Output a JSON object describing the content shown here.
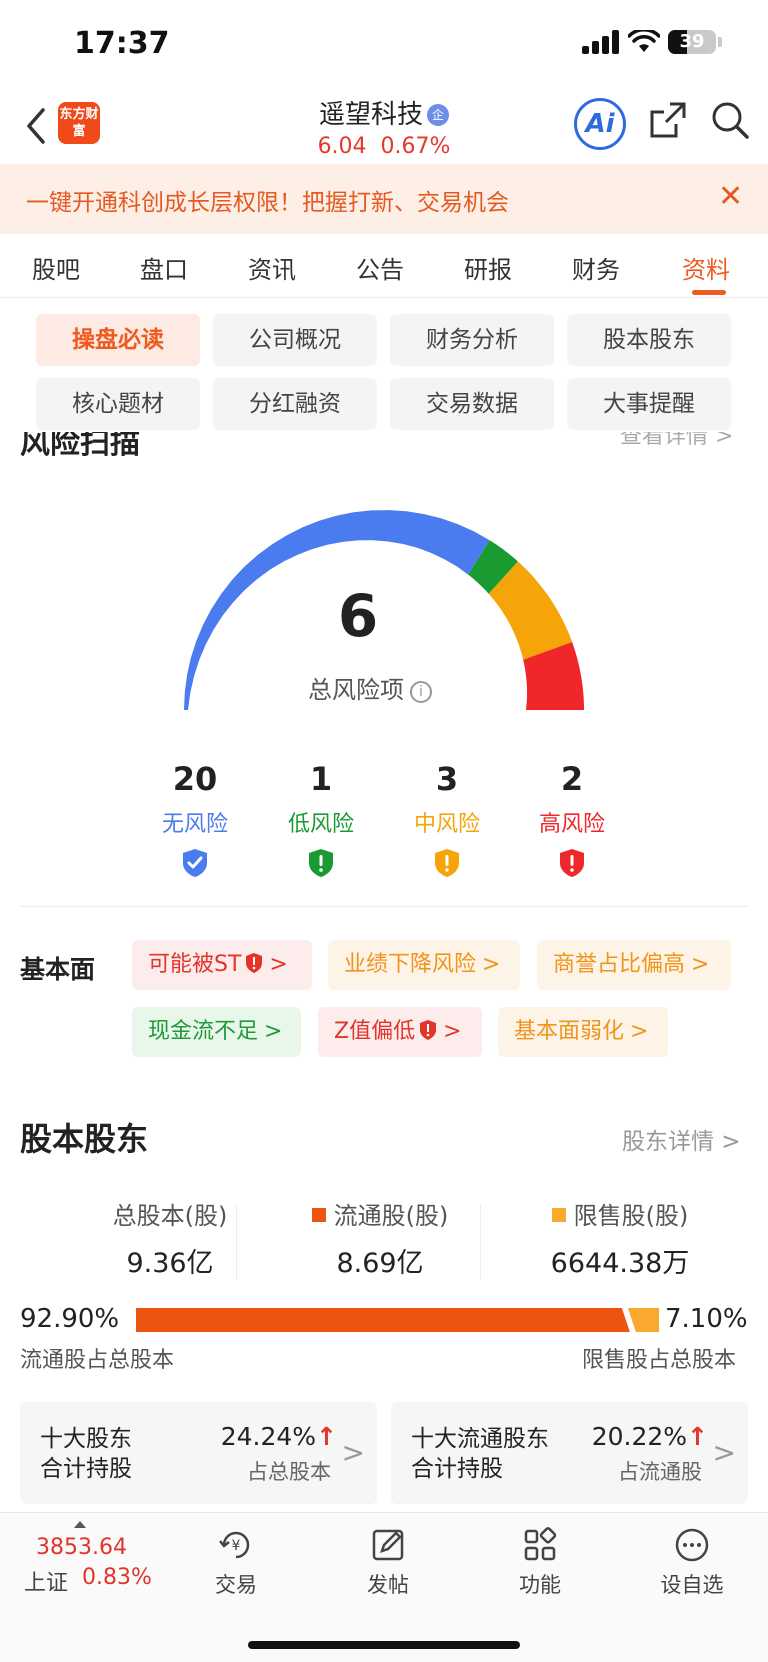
{
  "status": {
    "time": "17:37",
    "battery": "39"
  },
  "nav": {
    "logo": "东方财富",
    "title": "遥望科技",
    "badge": "企",
    "price": "6.04",
    "change": "0.67%",
    "ai_label": "Ai"
  },
  "banner": {
    "text": "一键开通科创成长层权限！把握打新、交易机会",
    "close": "✕"
  },
  "tabs": [
    "股吧",
    "盘口",
    "资讯",
    "公告",
    "研报",
    "财务",
    "资料"
  ],
  "chips": [
    "操盘必读",
    "公司概况",
    "财务分析",
    "股本股东",
    "核心题材",
    "分红融资",
    "交易数据",
    "大事提醒"
  ],
  "risk_section": {
    "title": "风险扫描",
    "link": "查看详情 >",
    "total": "6",
    "total_label": "总风险项",
    "info_icon": "i",
    "colors": {
      "none": "#4a7cf0",
      "low": "#1a9b32",
      "mid": "#f5a50a",
      "high": "#f0272a"
    },
    "gauge_values": {
      "none": 20,
      "low": 1,
      "mid": 3,
      "high": 2
    },
    "items": [
      {
        "count": "20",
        "label": "无风险"
      },
      {
        "count": "1",
        "label": "低风险"
      },
      {
        "count": "3",
        "label": "中风险"
      },
      {
        "count": "2",
        "label": "高风险"
      }
    ]
  },
  "fundamentals": {
    "label": "基本面",
    "tags": [
      {
        "text": "可能被ST",
        "chev": ">"
      },
      {
        "text": "业绩下降风险",
        "chev": ">"
      },
      {
        "text": "商誉占比偏高",
        "chev": ">"
      },
      {
        "text": "现金流不足",
        "chev": ">"
      },
      {
        "text": "Z值偏低",
        "chev": ">"
      },
      {
        "text": "基本面弱化",
        "chev": ">"
      }
    ]
  },
  "shareholders": {
    "title": "股本股东",
    "link": "股东详情 >",
    "total_label": "总股本(股)",
    "total_value": "9.36亿",
    "float_label": "流通股(股)",
    "float_value": "8.69亿",
    "restricted_label": "限售股(股)",
    "restricted_value": "6644.38万",
    "float_pct": "92.90%",
    "restricted_pct": "7.10%",
    "float_share": 0.929,
    "float_pct_label": "流通股占总股本",
    "restricted_pct_label": "限售股占总股本",
    "colors": {
      "float": "#ec5510",
      "restricted": "#f9aa2e"
    },
    "cards": [
      {
        "line1": "十大股东",
        "line2": "合计持股",
        "pct": "24.24%",
        "arrow": "↑",
        "sub": "占总股本",
        "chev": ">"
      },
      {
        "line1": "十大流通股东",
        "line2": "合计持股",
        "pct": "20.22%",
        "arrow": "↑",
        "sub": "占流通股",
        "chev": ">"
      }
    ]
  },
  "bottom": {
    "index_value": "3853.64",
    "index_name": "上证",
    "index_change": "0.83%",
    "items": [
      {
        "label": "交易",
        "icon": "trade-icon"
      },
      {
        "label": "发帖",
        "icon": "post-icon"
      },
      {
        "label": "功能",
        "icon": "function-icon"
      },
      {
        "label": "设自选",
        "icon": "watchlist-icon"
      }
    ]
  }
}
